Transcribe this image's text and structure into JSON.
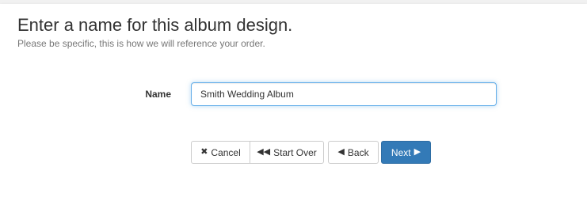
{
  "header": {
    "title": "Enter a name for this album design.",
    "subtitle": "Please be specific, this is how we will reference your order."
  },
  "form": {
    "name_label": "Name",
    "name_value": "Smith Wedding Album"
  },
  "buttons": {
    "cancel_label": "Cancel",
    "start_over_label": "Start Over",
    "back_label": "Back",
    "next_label": "Next"
  },
  "icons": {
    "cancel": "close-icon",
    "start_over": "fast-backward-icon",
    "back": "triangle-left-icon",
    "next": "triangle-right-icon"
  },
  "colors": {
    "primary": "#337ab7",
    "focus_border": "#66afe9"
  }
}
